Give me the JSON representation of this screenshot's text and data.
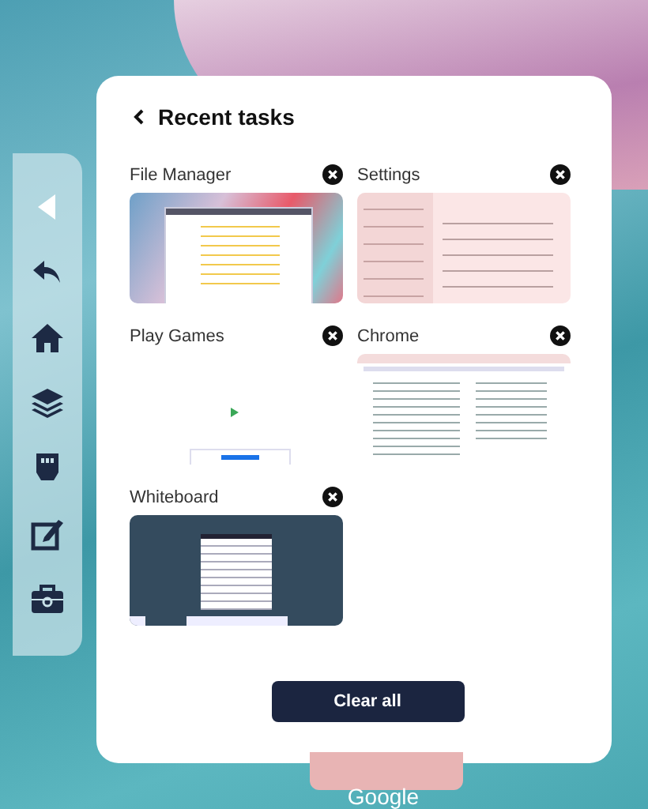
{
  "panel": {
    "title": "Recent tasks"
  },
  "tasks": [
    {
      "name": "File Manager",
      "kind": "files"
    },
    {
      "name": "Settings",
      "kind": "settings"
    },
    {
      "name": "Play Games",
      "kind": "blank"
    },
    {
      "name": "Chrome",
      "kind": "browser"
    },
    {
      "name": "Whiteboard",
      "kind": "board"
    }
  ],
  "clear_button": "Clear all",
  "desktop_folder": {
    "label": "Google"
  }
}
